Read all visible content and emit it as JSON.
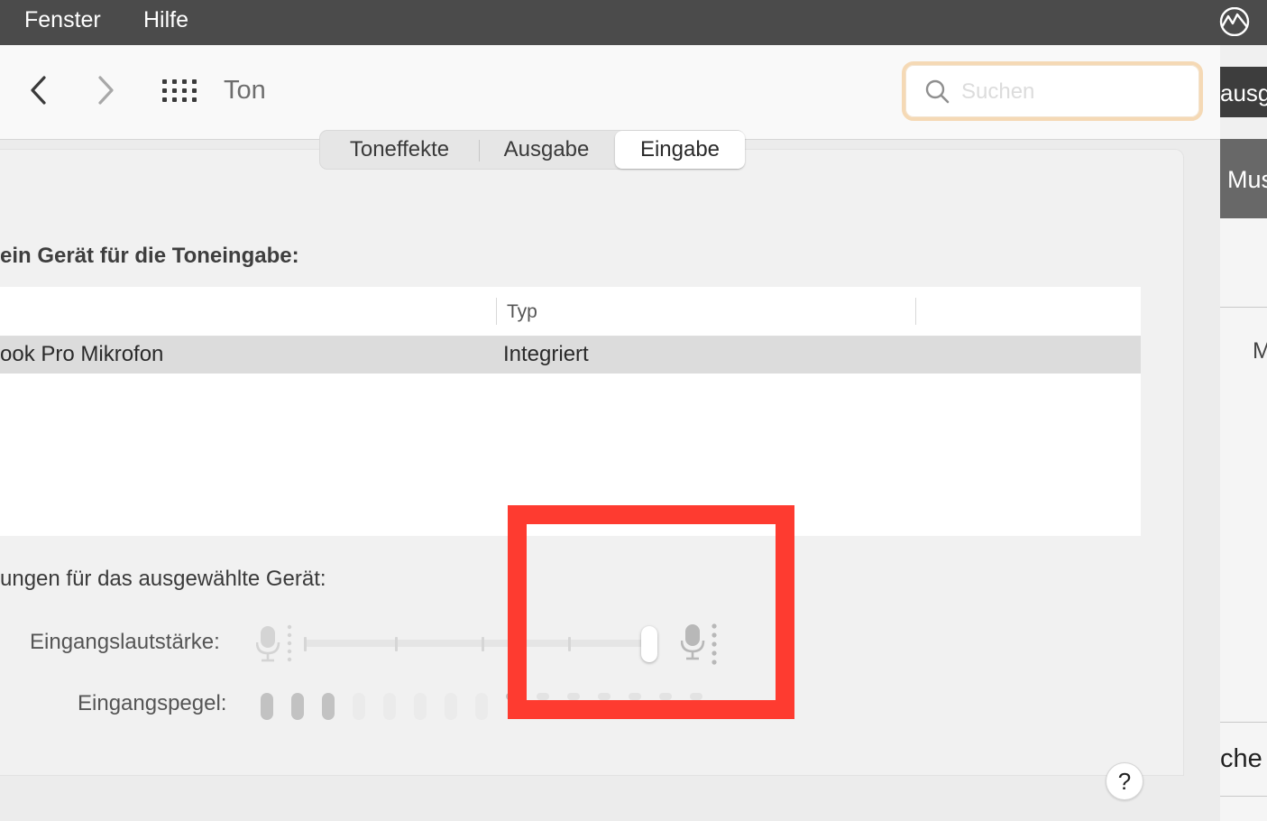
{
  "menubar": {
    "items": [
      {
        "label": "Fenster"
      },
      {
        "label": "Hilfe"
      }
    ],
    "tray_icon": "mountain-logo-icon"
  },
  "toolbar": {
    "back_icon": "chevron-left-icon",
    "forward_icon": "chevron-right-icon",
    "grid_icon": "grid-icon",
    "title": "Ton",
    "search_placeholder": "Suchen"
  },
  "tabs": [
    {
      "label": "Toneffekte",
      "selected": false
    },
    {
      "label": "Ausgabe",
      "selected": false
    },
    {
      "label": "Eingabe",
      "selected": true
    }
  ],
  "input": {
    "section_label": "ein Gerät für die Toneingabe:",
    "table": {
      "columns": [
        "",
        "Typ"
      ],
      "rows": [
        {
          "name": "ook Pro Mikrofon",
          "type": "Integriert",
          "selected": true
        }
      ]
    },
    "settings_label": "ungen für das ausgewählte Gerät:",
    "volume_label": "Eingangslautstärke:",
    "volume_value": 1.0,
    "level_label": "Eingangspegel:",
    "level_active_bars": 3,
    "level_total_bars": 15
  },
  "background_window": {
    "ausg": "ausg",
    "mus": "Mus",
    "m": "M",
    "che": "che"
  },
  "help_label": "?",
  "colors": {
    "highlight": "#fe3b30",
    "search_focus": "#f5d9b5",
    "menubar": "#4b4b4b"
  }
}
